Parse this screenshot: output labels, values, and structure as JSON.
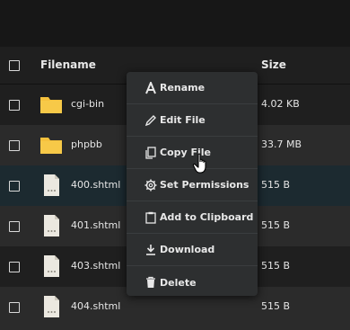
{
  "table": {
    "header": {
      "name": "Filename",
      "size": "Size"
    },
    "rows": [
      {
        "name": "cgi-bin",
        "size": "4.02 KB",
        "type": "folder"
      },
      {
        "name": "phpbb",
        "size": "33.7 MB",
        "type": "folder"
      },
      {
        "name": "400.shtml",
        "size": "515 B",
        "type": "file"
      },
      {
        "name": "401.shtml",
        "size": "515 B",
        "type": "file"
      },
      {
        "name": "403.shtml",
        "size": "515 B",
        "type": "file"
      },
      {
        "name": "404.shtml",
        "size": "515 B",
        "type": "file"
      }
    ]
  },
  "context_menu": {
    "items": [
      {
        "label": "Rename",
        "icon": "rename-icon"
      },
      {
        "label": "Edit File",
        "icon": "pencil-icon"
      },
      {
        "label": "Copy File",
        "icon": "copy-icon"
      },
      {
        "label": "Set Permissions",
        "icon": "gear-icon"
      },
      {
        "label": "Add to Clipboard",
        "icon": "clipboard-icon"
      },
      {
        "label": "Download",
        "icon": "download-icon"
      },
      {
        "label": "Delete",
        "icon": "trash-icon"
      }
    ]
  },
  "colors": {
    "background": "#1c1c1c",
    "row_alt": "#2b2b2b",
    "row_selected": "#1c2a30",
    "folder": "#f5c13d",
    "menu_bg": "#2d2f30"
  }
}
